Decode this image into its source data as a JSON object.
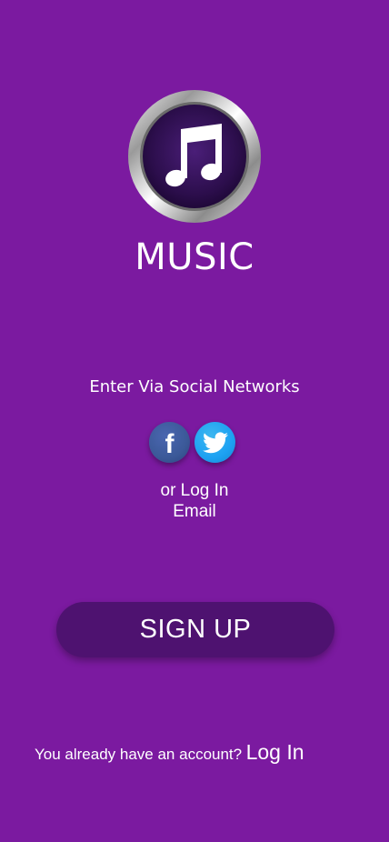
{
  "app": {
    "title": "MUSIC",
    "logo_icon": "music-note-icon"
  },
  "social": {
    "heading": "Enter Via Social Networks",
    "networks": [
      {
        "name": "facebook",
        "icon": "facebook-icon",
        "color": "#3b5998"
      },
      {
        "name": "twitter",
        "icon": "twitter-icon",
        "color": "#1da1f2"
      }
    ]
  },
  "alt_login": {
    "line1": "or Log In",
    "line2": "Email"
  },
  "signup": {
    "label": "SIGN UP"
  },
  "footer": {
    "text": "You already have an account?",
    "link": "Log In"
  },
  "colors": {
    "background": "#7b1aa0",
    "button": "#4e1270",
    "text": "#ffffff"
  }
}
